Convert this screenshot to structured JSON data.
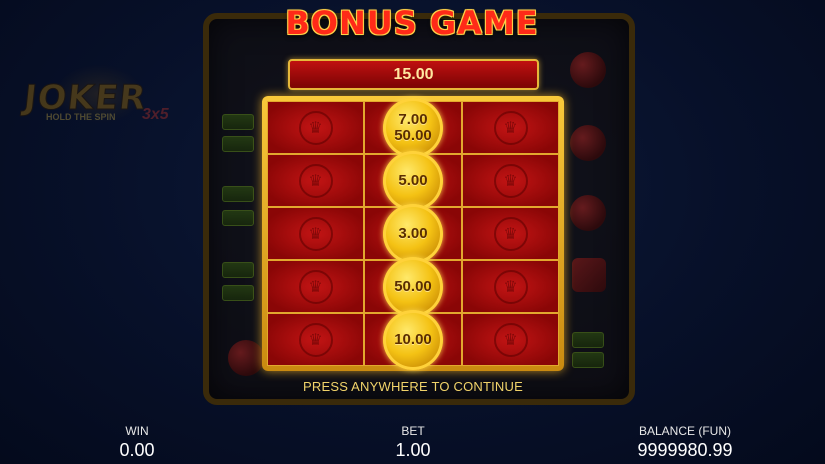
{
  "title": "BONUS GAME",
  "total_win": "15.00",
  "logo": {
    "main": "JOKER",
    "sub": "HOLD THE SPIN",
    "variant": "3x5"
  },
  "continue_prompt": "PRESS ANYWHERE TO CONTINUE",
  "grid": {
    "rows": [
      [
        {
          "coin": null
        },
        {
          "coin": [
            "7.00",
            "50.00"
          ]
        },
        {
          "coin": null
        }
      ],
      [
        {
          "coin": null
        },
        {
          "coin": [
            "5.00"
          ]
        },
        {
          "coin": null
        }
      ],
      [
        {
          "coin": null
        },
        {
          "coin": [
            "3.00"
          ]
        },
        {
          "coin": null
        }
      ],
      [
        {
          "coin": null
        },
        {
          "coin": [
            "50.00"
          ]
        },
        {
          "coin": null
        }
      ],
      [
        {
          "coin": null
        },
        {
          "coin": [
            "10.00"
          ]
        },
        {
          "coin": null
        }
      ]
    ]
  },
  "stats": {
    "win": {
      "label": "WIN",
      "value": "0.00"
    },
    "bet": {
      "label": "BET",
      "value": "1.00"
    },
    "balance": {
      "label": "BALANCE (FUN)",
      "value": "9999980.99"
    }
  },
  "colors": {
    "accent": "#ff2a18",
    "gold": "#f4c214",
    "cell": "#b00c0c",
    "prompt": "#f1d36a"
  },
  "icons": {
    "empty_cell": "joker-emblem-icon"
  }
}
